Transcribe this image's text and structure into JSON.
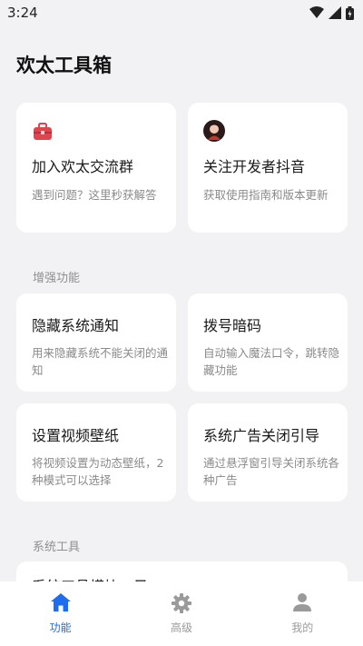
{
  "status_bar": {
    "time": "3:24"
  },
  "app_title": "欢太工具箱",
  "top_cards": [
    {
      "title": "加入欢太交流群",
      "desc": "遇到问题？这里秒获解答",
      "icon": "toolbox-icon"
    },
    {
      "title": "关注开发者抖音",
      "desc": "获取使用指南和版本更新",
      "icon": "developer-avatar"
    }
  ],
  "sections": [
    {
      "label": "增强功能",
      "cards": [
        {
          "title": "隐藏系统通知",
          "desc": "用来隐藏系统不能关闭的通知"
        },
        {
          "title": "拨号暗码",
          "desc": "自动输入魔法口令，跳转隐藏功能"
        },
        {
          "title": "设置视频壁纸",
          "desc": "将视频设置为动态壁纸，2种模式可以选择"
        },
        {
          "title": "系统广告关闭引导",
          "desc": "通过悬浮窗引导关闭系统各种广告"
        }
      ]
    },
    {
      "label": "系统工具",
      "cards": [
        {
          "title": "系统工具模块一目"
        }
      ]
    }
  ],
  "bottom_nav": [
    {
      "label": "功能",
      "icon": "home-icon",
      "active": true
    },
    {
      "label": "高级",
      "icon": "gear-icon",
      "active": false
    },
    {
      "label": "我的",
      "icon": "person-icon",
      "active": false
    }
  ],
  "colors": {
    "accent": "#1e6cf0",
    "inactive": "#9a9a9a",
    "background": "#f2f2f5"
  }
}
